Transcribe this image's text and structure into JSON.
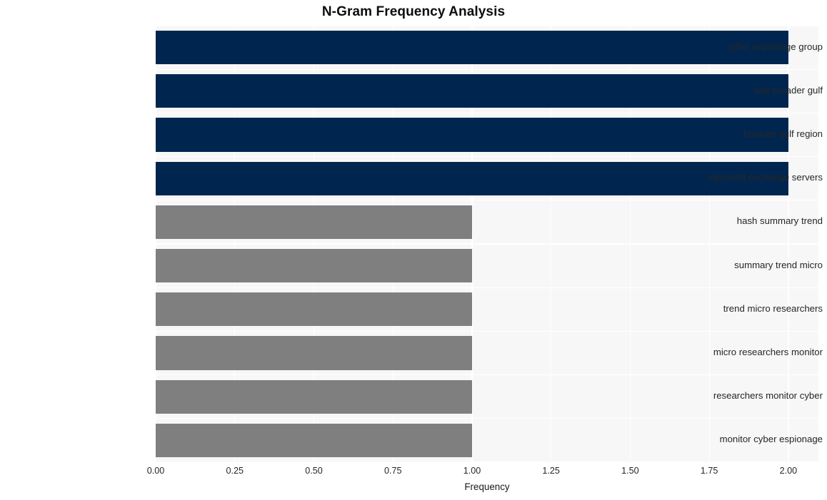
{
  "chart_data": {
    "type": "bar",
    "orientation": "horizontal",
    "title": "N-Gram Frequency Analysis",
    "xlabel": "Frequency",
    "ylabel": "",
    "categories": [
      "cyber espionage group",
      "uae broader gulf",
      "broader gulf region",
      "microsoft exchange servers",
      "hash summary trend",
      "summary trend micro",
      "trend micro researchers",
      "micro researchers monitor",
      "researchers monitor cyber",
      "monitor cyber espionage"
    ],
    "values": [
      2,
      2,
      2,
      2,
      1,
      1,
      1,
      1,
      1,
      1
    ],
    "bar_colors": [
      "#00264f",
      "#00264f",
      "#00264f",
      "#00264f",
      "#7f7f7f",
      "#7f7f7f",
      "#7f7f7f",
      "#7f7f7f",
      "#7f7f7f",
      "#7f7f7f"
    ],
    "xlim": [
      0,
      2.095
    ],
    "xticks": [
      0,
      0.25,
      0.5,
      0.75,
      1.0,
      1.25,
      1.5,
      1.75,
      2.0
    ],
    "xtick_labels": [
      "0.00",
      "0.25",
      "0.50",
      "0.75",
      "1.00",
      "1.25",
      "1.50",
      "1.75",
      "2.00"
    ],
    "grid": true,
    "grid_color": "#ffffff",
    "plot_background": "#f7f7f7",
    "figure_background": "#ffffff",
    "legend": null,
    "title_color": "#0d0d0d",
    "tick_label_color": "#262626"
  }
}
